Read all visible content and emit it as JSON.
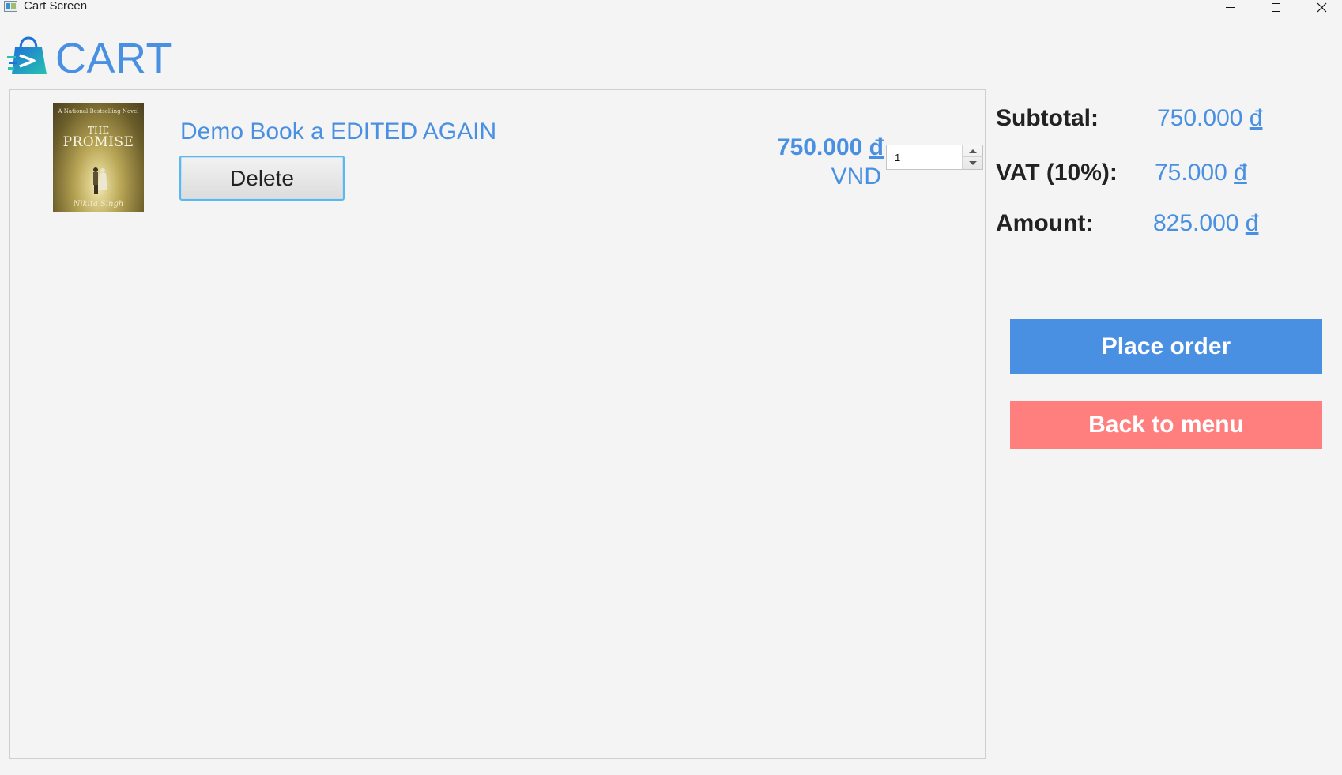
{
  "window": {
    "title": "Cart Screen",
    "controls": {
      "minimize": "minimize",
      "maximize": "maximize",
      "close": "close"
    }
  },
  "header": {
    "title": "CART",
    "logo_icon": "shopping-bag-icon"
  },
  "cart_items": [
    {
      "title": "Demo Book a EDITED AGAIN",
      "delete_label": "Delete",
      "price_amount": "750.000 ",
      "price_symbol": "đ",
      "currency": "VND",
      "quantity": "1",
      "cover": {
        "top_text": "A National Bestselling Novel",
        "the": "THE",
        "title": "PROMISE",
        "author": "Nikita Singh"
      }
    }
  ],
  "summary": {
    "subtotal_label": "Subtotal:",
    "subtotal_amount": "750.000 ",
    "vat_label": "VAT (10%):",
    "vat_amount": "75.000 ",
    "amount_label": "Amount:",
    "amount_amount": "825.000 ",
    "currency_symbol": "đ"
  },
  "actions": {
    "place_order": "Place order",
    "back_to_menu": "Back to menu"
  },
  "colors": {
    "accent": "#4a90e2",
    "back_button": "#ff7f7f",
    "background": "#f4f4f4"
  }
}
